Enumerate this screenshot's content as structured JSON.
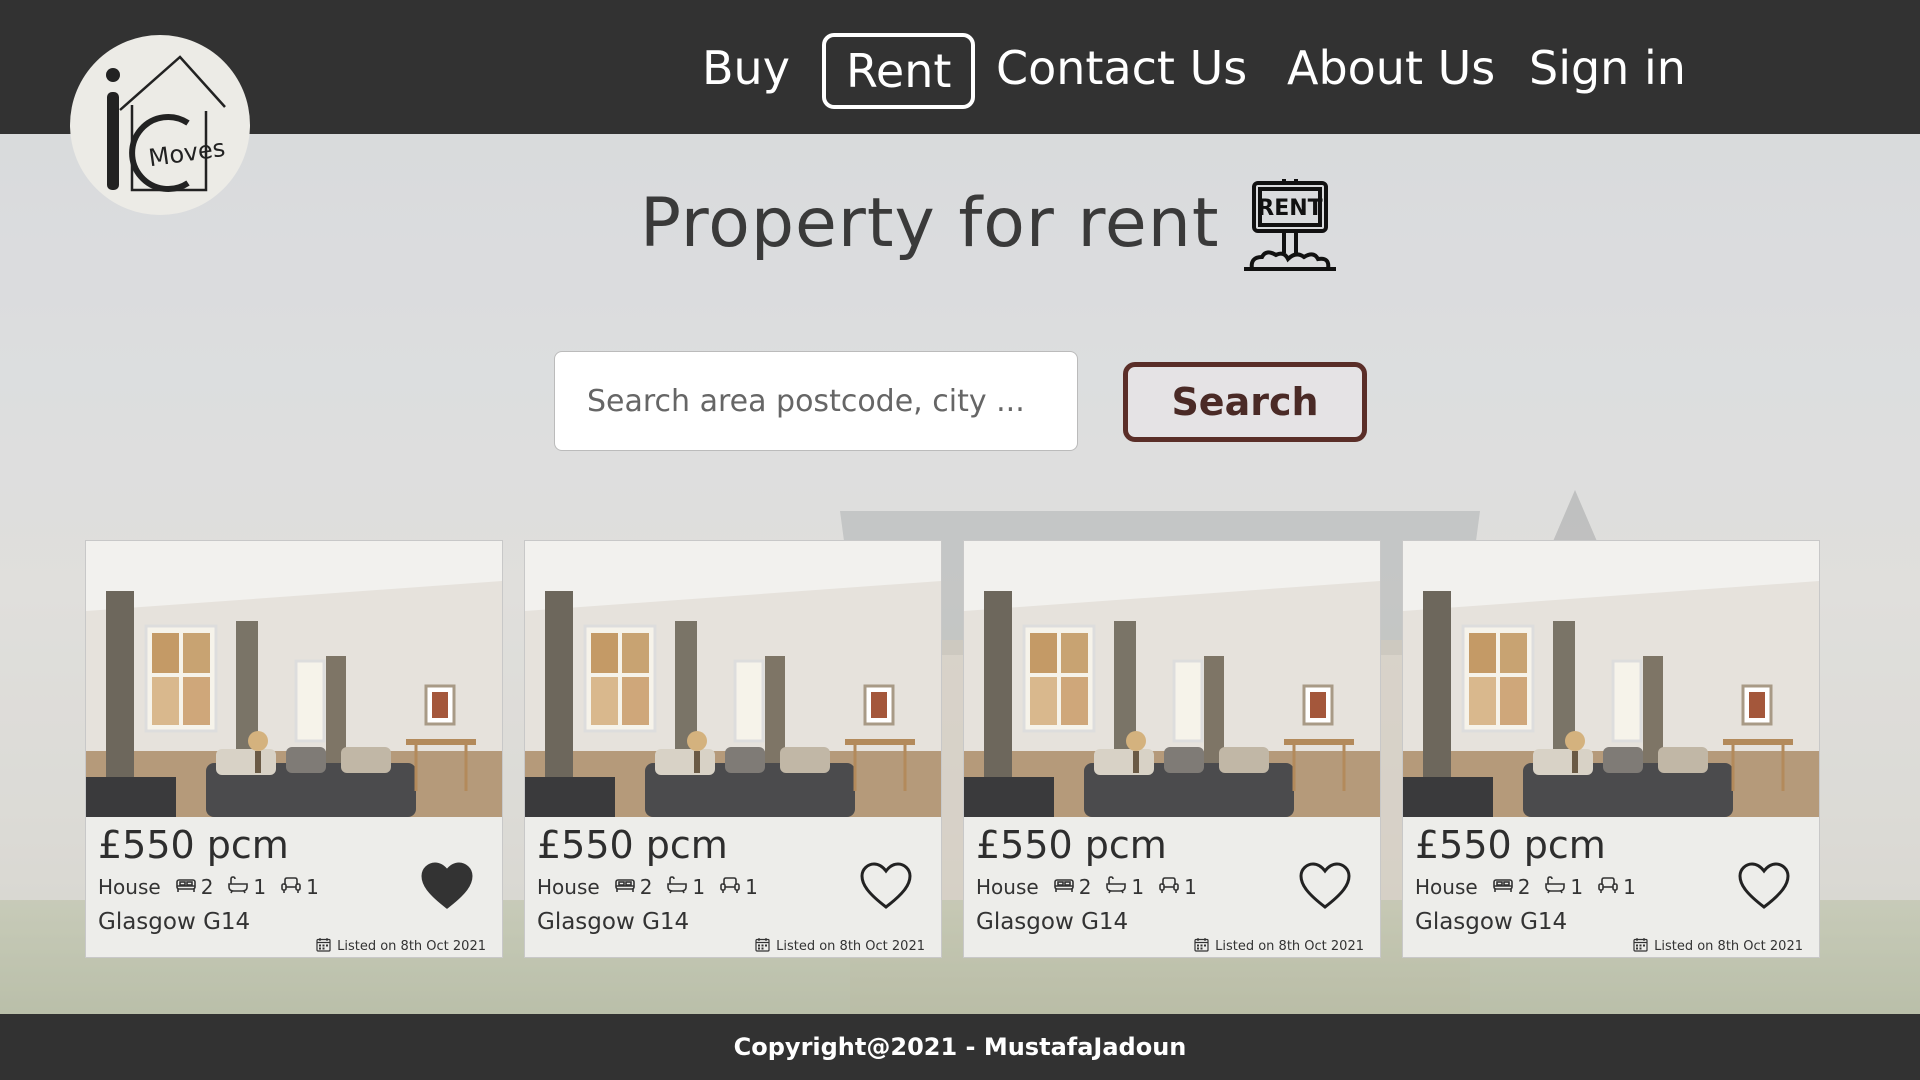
{
  "header": {
    "logo_alt": "iC Moves",
    "nav": [
      {
        "label": "Buy"
      },
      {
        "label": "Rent"
      },
      {
        "label": "Contact Us"
      },
      {
        "label": "About Us"
      },
      {
        "label": "Sign in"
      }
    ],
    "active_nav": "Rent"
  },
  "main": {
    "title": "Property for rent",
    "sign_text": "RENT",
    "search": {
      "placeholder": "Search area postcode, city ...",
      "value": "",
      "button_label": "Search"
    },
    "listings": [
      {
        "price": "£550 pcm",
        "type": "House",
        "bedrooms": "2",
        "bathrooms": "1",
        "receptions": "1",
        "location": "Glasgow G14",
        "listed": "Listed on 8th Oct 2021",
        "favorited": true
      },
      {
        "price": "£550 pcm",
        "type": "House",
        "bedrooms": "2",
        "bathrooms": "1",
        "receptions": "1",
        "location": "Glasgow G14",
        "listed": "Listed on 8th Oct 2021",
        "favorited": false
      },
      {
        "price": "£550 pcm",
        "type": "House",
        "bedrooms": "2",
        "bathrooms": "1",
        "receptions": "1",
        "location": "Glasgow G14",
        "listed": "Listed on 8th Oct 2021",
        "favorited": false
      },
      {
        "price": "£550 pcm",
        "type": "House",
        "bedrooms": "2",
        "bathrooms": "1",
        "receptions": "1",
        "location": "Glasgow G14",
        "listed": "Listed on 8th Oct 2021",
        "favorited": false
      }
    ]
  },
  "footer": {
    "copyright": "Copyright@2021 - MustafaJadoun"
  },
  "colors": {
    "header_bg": "#323232",
    "search_button_border": "#5a2e28",
    "card_bg": "#ededea"
  }
}
